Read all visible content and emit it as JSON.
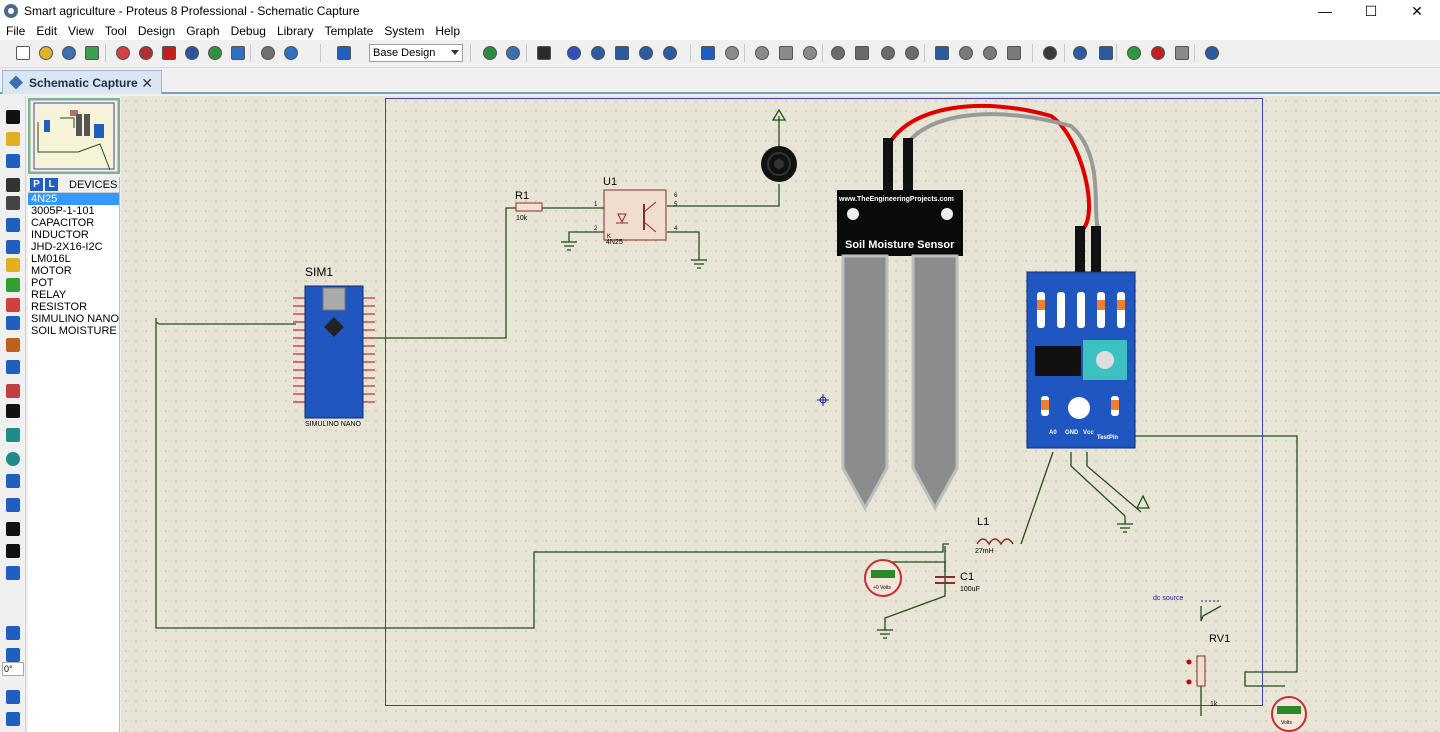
{
  "window": {
    "title": "Smart agriculture - Proteus 8 Professional - Schematic Capture",
    "controls": {
      "minimize": "—",
      "maximize": "☐",
      "close": "✕"
    }
  },
  "menu": [
    "File",
    "Edit",
    "View",
    "Tool",
    "Design",
    "Graph",
    "Debug",
    "Library",
    "Template",
    "System",
    "Help"
  ],
  "toolbar": {
    "design_combo": "Base Design",
    "icons": [
      "new-icon",
      "open-icon",
      "save-icon",
      "import-icon",
      "home-icon",
      "component-icon",
      "pcb-icon",
      "3d-icon",
      "gerber-icon",
      "bom-icon",
      "design-explorer-icon",
      "vsm-icon",
      "help-icon",
      "refresh-icon",
      "grid-icon",
      "origin-icon",
      "pan-icon",
      "zoom-in-icon",
      "zoom-out-icon",
      "zoom-all-icon",
      "zoom-area-icon",
      "undo-icon",
      "redo-icon",
      "cut-icon",
      "copy-icon",
      "paste-icon",
      "block-copy-icon",
      "block-move-icon",
      "block-rotate-icon",
      "block-delete-icon",
      "pick-icon",
      "make-device-icon",
      "packaging-icon",
      "decompose-icon",
      "wire-autorouter-icon",
      "search-icon",
      "property-assign-icon",
      "new-sheet-icon",
      "remove-sheet-icon",
      "goto-sheet-icon",
      "netlist-icon"
    ]
  },
  "tabs": [
    {
      "label": "Schematic Capture"
    }
  ],
  "left_tools": [
    "select-icon",
    "component-mode-icon",
    "junction-icon",
    "wire-label-icon",
    "text-script-icon",
    "bus-icon",
    "subcircuit-icon",
    "terminals-icon",
    "device-pins-icon",
    "graph-icon",
    "tape-recorder-icon",
    "generator-icon",
    "voltage-probe-icon",
    "virtual-instruments-icon",
    "line-icon",
    "box-icon",
    "circle-icon",
    "arc-icon",
    "path-icon",
    "text-icon",
    "symbol-icon",
    "marker-icon",
    "rotate-cw-icon",
    "rotate-ccw-icon",
    "mirror-x-icon",
    "mirror-y-icon"
  ],
  "rotation_value": "0°",
  "devices": {
    "header_p": "P",
    "header_l": "L",
    "title": "DEVICES",
    "items": [
      "4N25",
      "3005P-1-101",
      "CAPACITOR",
      "INDUCTOR",
      "JHD-2X16-I2C",
      "LM016L",
      "MOTOR",
      "POT",
      "RELAY",
      "RESISTOR",
      "SIMULINO NANO",
      "SOIL MOISTURE"
    ],
    "selected_index": 0
  },
  "schematic": {
    "r1": {
      "ref": "R1",
      "value": "10k"
    },
    "u1": {
      "ref": "U1",
      "part": "4N25",
      "pins": [
        "1",
        "2",
        "4",
        "5",
        "6"
      ],
      "pin_k": "K"
    },
    "sim1": {
      "ref": "SIM1",
      "part": "SIMULINO NANO"
    },
    "sensor": {
      "site": "www.TheEngineeringProjects.com",
      "title": "Soil Moisture Sensor",
      "pins": [
        "A0",
        "GND",
        "Vcc",
        "TestPin"
      ]
    },
    "l1": {
      "ref": "L1",
      "value": "27mH"
    },
    "c1": {
      "ref": "C1",
      "value": "100uF"
    },
    "voltmeter1": {
      "reading": "+0 Volts"
    },
    "voltmeter2": {
      "reading": "Volts"
    },
    "rv1": {
      "ref": "RV1",
      "value": "1k"
    },
    "dc_source": {
      "label": "dc source"
    }
  }
}
